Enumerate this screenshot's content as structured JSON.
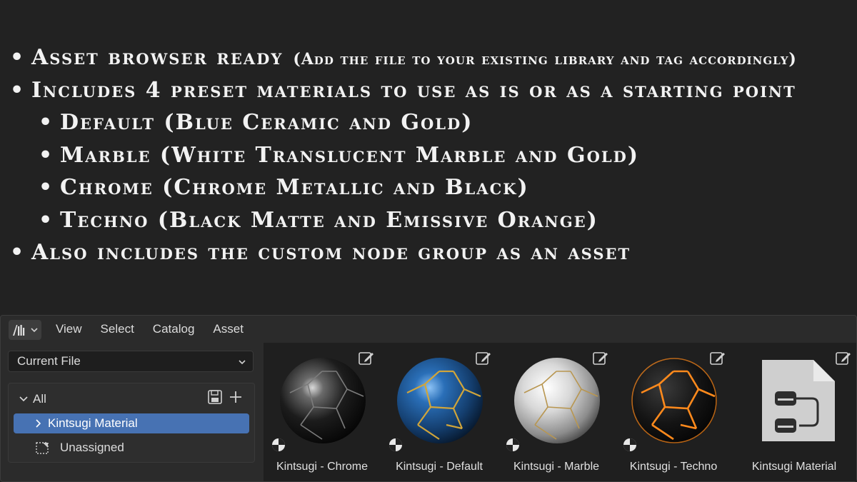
{
  "features": [
    {
      "text": "Asset browser ready",
      "note": "(Add the file to your existing library and tag accordingly)",
      "level": 1
    },
    {
      "text": "Includes 4 preset materials to use as is or as a starting point",
      "level": 1
    },
    {
      "text": "Default (Blue Ceramic and Gold)",
      "level": 2
    },
    {
      "text": "Marble (White Translucent Marble and Gold)",
      "level": 2
    },
    {
      "text": "Chrome (Chrome Metallic and Black)",
      "level": 2
    },
    {
      "text": "Techno (Black Matte and Emissive Orange)",
      "level": 2
    },
    {
      "text": "Also includes the custom node group as an asset",
      "level": 1
    }
  ],
  "browser": {
    "editor_type_icon": "asset-browser-icon",
    "menu": [
      "View",
      "Select",
      "Catalog",
      "Asset"
    ],
    "library_select": "Current File",
    "catalog": {
      "root": "All",
      "active": "Kintsugi Material",
      "unassigned": "Unassigned"
    },
    "assets": [
      {
        "name": "Kintsugi - Chrome",
        "kind": "material",
        "colors": {
          "base": "#1a1a1a",
          "highlight": "#9a9a9a",
          "crack": "#6e6e6e"
        }
      },
      {
        "name": "Kintsugi - Default",
        "kind": "material",
        "colors": {
          "base": "#1f5a9e",
          "highlight": "#5aa0e0",
          "crack": "#c9a13a"
        }
      },
      {
        "name": "Kintsugi - Marble",
        "kind": "material",
        "colors": {
          "base": "#cfcfcf",
          "highlight": "#ffffff",
          "crack": "#b89650"
        }
      },
      {
        "name": "Kintsugi - Techno",
        "kind": "material",
        "colors": {
          "base": "#161616",
          "highlight": "#3a3a3a",
          "crack": "#ff8a1c"
        }
      },
      {
        "name": "Kintsugi Material",
        "kind": "node-group",
        "colors": {
          "base": "#cfcfcf"
        }
      }
    ]
  },
  "colors": {
    "accent": "#4772b3",
    "background": "#222222",
    "panel": "#2b2b2b"
  }
}
